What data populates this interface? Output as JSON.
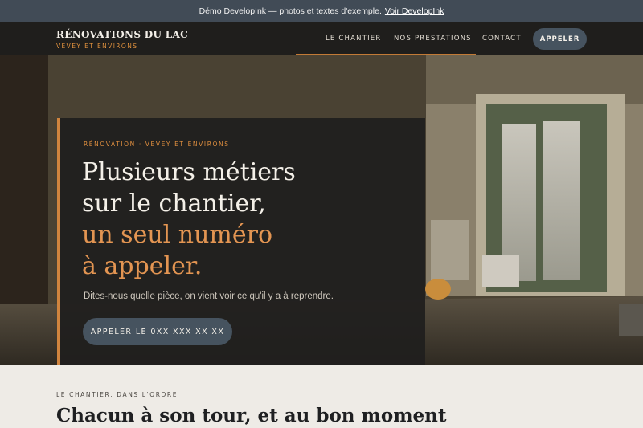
{
  "demo_banner": {
    "text": "Démo DevelopInk — photos et textes d'exemple.",
    "link": "Voir DevelopInk"
  },
  "nav": {
    "brand_name": "RÉNOVATIONS DU LAC",
    "brand_sub": "VEVEY ET ENVIRONS",
    "links": [
      "LE CHANTIER",
      "NOS PRESTATIONS",
      "CONTACT"
    ],
    "call_button": "APPELER"
  },
  "hero": {
    "eyebrow": "RÉNOVATION · VEVEY ET ENVIRONS",
    "headline_line1": "Plusieurs métiers",
    "headline_line2": "sur le chantier,",
    "headline_accent1": "un seul numéro",
    "headline_accent2": "à appeler.",
    "lead": "Dites-nous quelle pièce, on vient voir ce qu'il y a à reprendre.",
    "cta": "APPELER LE 0XX XXX XX XX"
  },
  "section": {
    "eyebrow": "LE CHANTIER, DANS L'ORDRE",
    "title": "Chacun à son tour, et au bon moment"
  },
  "colors": {
    "accent": "#e08f3f",
    "button": "#46535f",
    "dark": "#1f1e1c",
    "banner": "#414b56"
  }
}
